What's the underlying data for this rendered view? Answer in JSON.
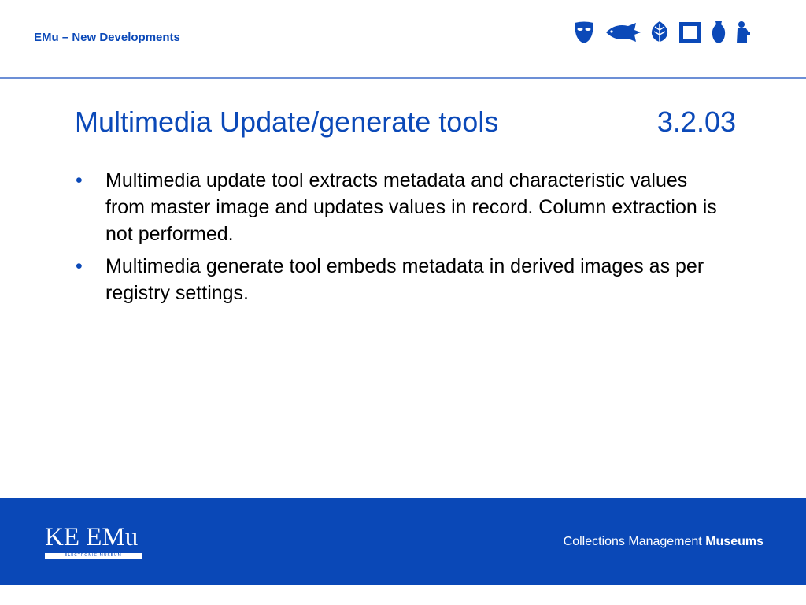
{
  "header": {
    "title": "EMu – New Developments",
    "icons": [
      "mask-icon",
      "fish-icon",
      "leaf-icon",
      "frame-icon",
      "vase-icon",
      "figure-icon"
    ]
  },
  "slide": {
    "title": "Multimedia Update/generate tools",
    "number": "3.2.03",
    "bullets": [
      "Multimedia update tool extracts metadata and characteristic values from master image and updates values in record. Column extraction is not performed.",
      "Multimedia generate tool embeds metadata in derived images as per registry settings."
    ],
    "bullet_glyph": "•"
  },
  "footer": {
    "logo_text": "KE EMu",
    "logo_subtext": "ELECTRONIC MUSEUM",
    "tagline_regular": "Collections Management ",
    "tagline_bold": "Museums"
  },
  "colors": {
    "brand_blue": "#0b49b8",
    "footer_blue": "#0a48b7",
    "rule": "#6c8fd6"
  }
}
